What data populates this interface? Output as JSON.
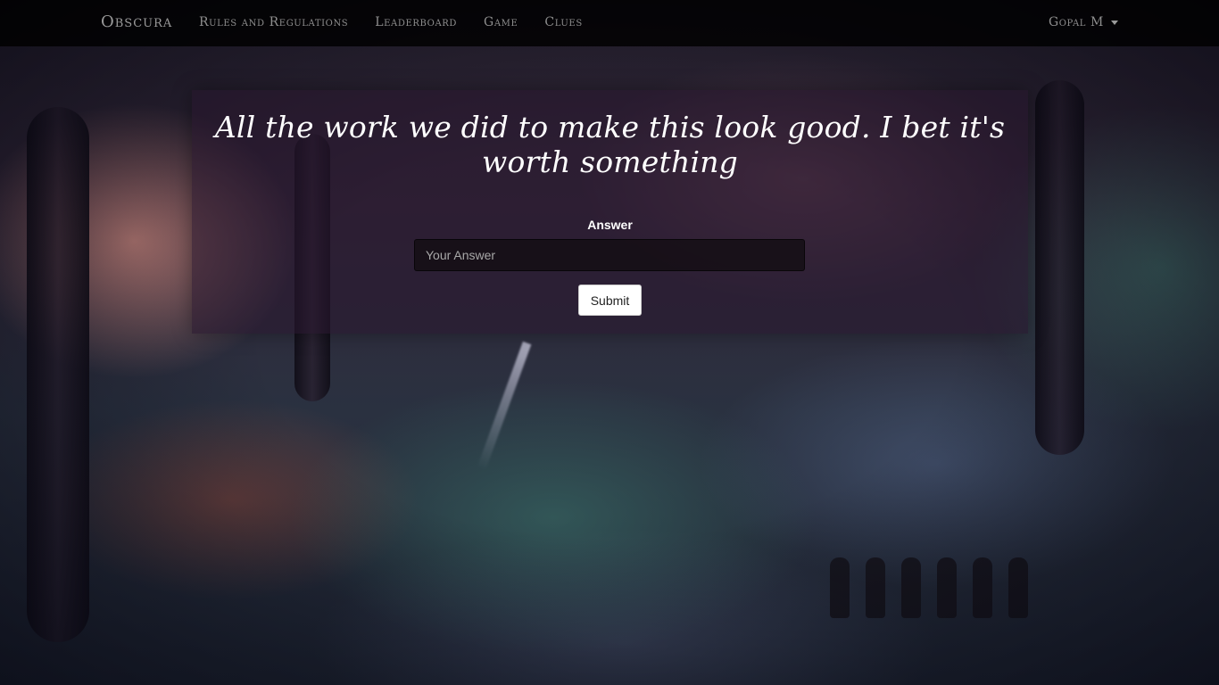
{
  "navbar": {
    "brand": "Obscura",
    "links": [
      {
        "label": "Rules and Regulations"
      },
      {
        "label": "Leaderboard"
      },
      {
        "label": "Game"
      },
      {
        "label": "Clues"
      }
    ],
    "user": {
      "name": "Gopal M",
      "dropdown_icon": "caret-down-icon"
    }
  },
  "question": {
    "text": "All the work we did to make this look good. I bet it's worth something"
  },
  "form": {
    "answer_label": "Answer",
    "answer_placeholder": "Your Answer",
    "answer_value": "",
    "submit_label": "Submit"
  },
  "colors": {
    "navbar_bg": "#000000",
    "panel_bg": "#28162d",
    "text_primary": "#ffffff",
    "nav_text": "#8e8e8e"
  }
}
